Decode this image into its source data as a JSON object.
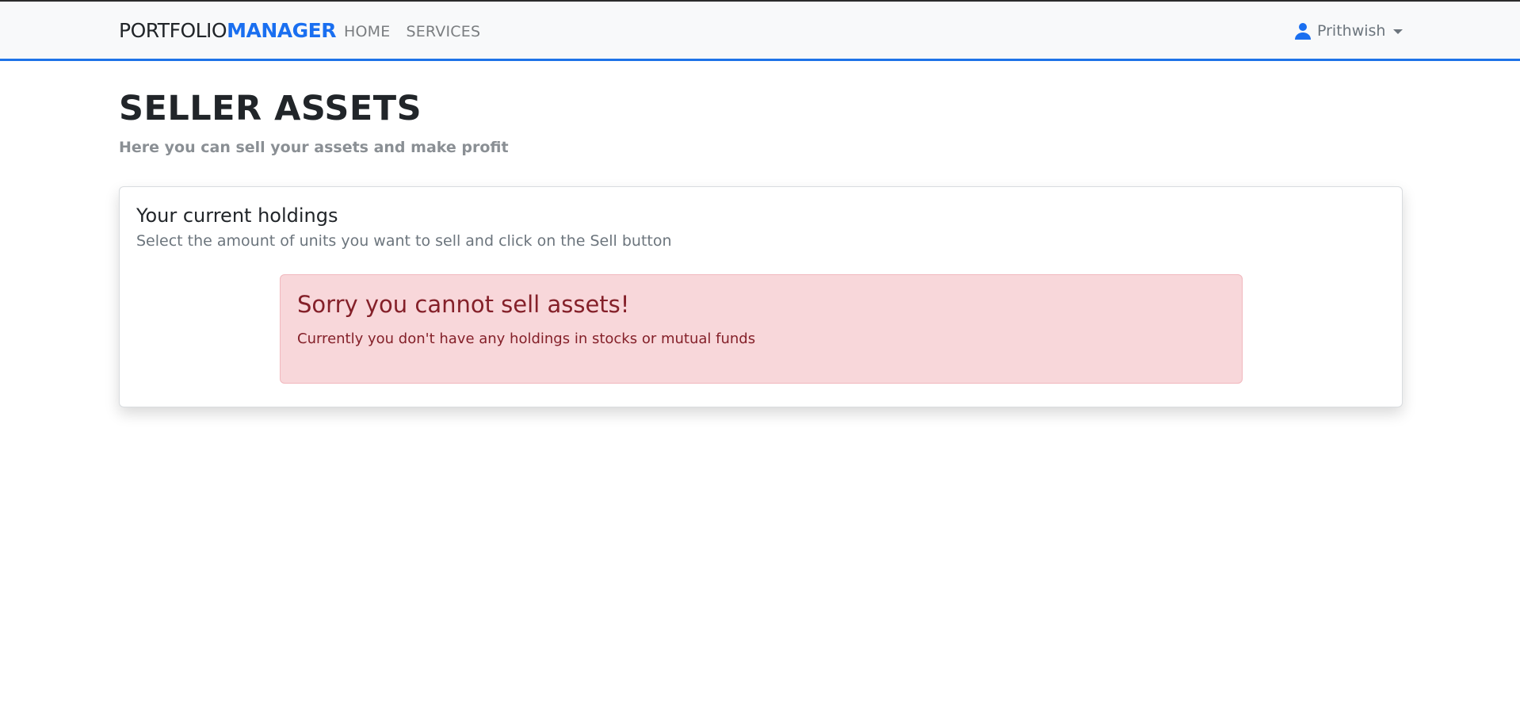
{
  "navbar": {
    "brand_part1": "PORTFOLIO",
    "brand_part2": "MANAGER",
    "links": [
      {
        "label": "HOME"
      },
      {
        "label": "SERVICES"
      }
    ],
    "user": {
      "name": "Prithwish",
      "icon": "user-icon"
    }
  },
  "header": {
    "title": "SELLER ASSETS",
    "subtitle": "Here you can sell your assets and make profit"
  },
  "holdings_card": {
    "title": "Your current holdings",
    "subtitle": "Select the amount of units you want to sell and click on the Sell button",
    "alert": {
      "heading": "Sorry you cannot sell assets!",
      "message": "Currently you don't have any holdings in stocks or mutual funds"
    }
  },
  "colors": {
    "accent": "#1a6ff0",
    "navbar_bg": "#f8f9fa",
    "alert_bg": "#f8d7da",
    "alert_text": "#842029"
  }
}
